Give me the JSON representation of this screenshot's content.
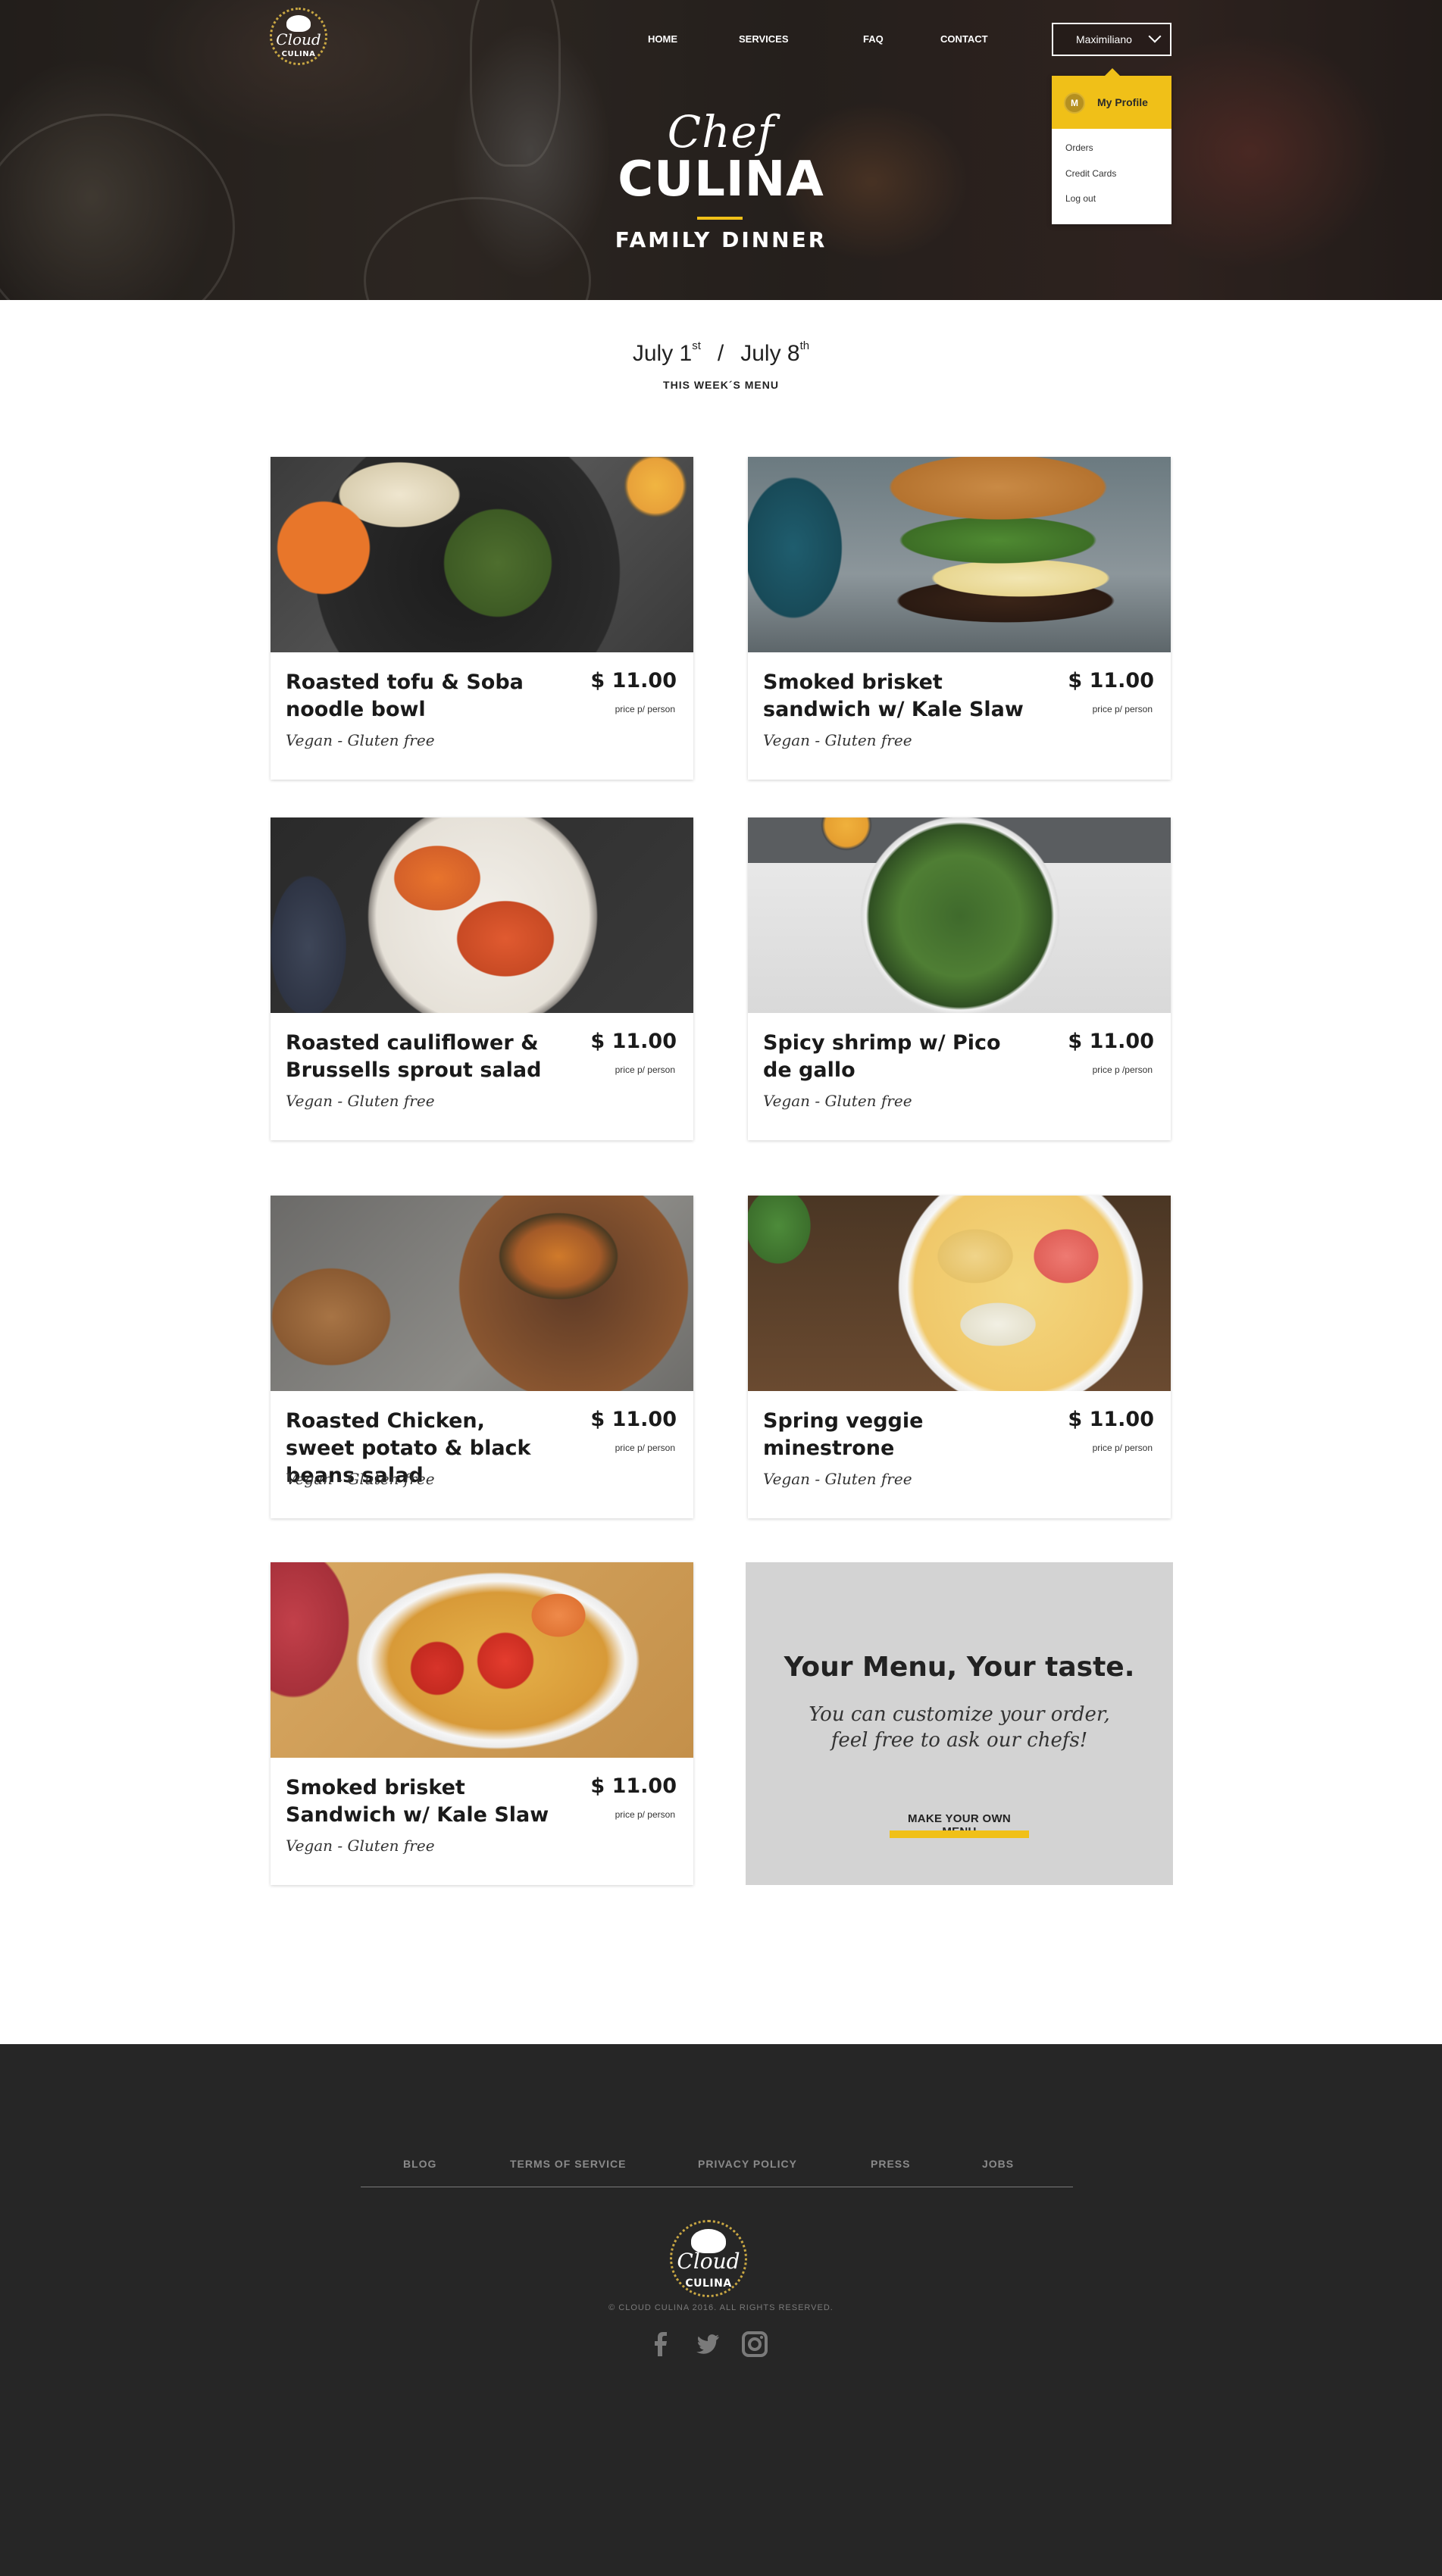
{
  "brand": {
    "logo_script": "Cloud",
    "logo_word": "CULINA"
  },
  "nav": {
    "home": "HOME",
    "services": "SERVICES",
    "faq": "FAQ",
    "contact": "CONTACT"
  },
  "user_menu": {
    "name": "Maximiliano",
    "avatar_letter": "M",
    "profile_label": "My Profile",
    "items": [
      "Orders",
      "Credit Cards",
      "Log out"
    ],
    "accent_color": "#f0c018"
  },
  "hero": {
    "script_title": "Chef",
    "main_title": "CULINA",
    "subtitle": "FAMILY DINNER"
  },
  "week": {
    "start_day": "July 1",
    "start_suffix": "st",
    "separator": "/",
    "end_day": "July 8",
    "end_suffix": "th",
    "label": "THIS WEEK´S MENU"
  },
  "menu": [
    {
      "title": "Roasted tofu & Soba noodle bowl",
      "price": "$ 11.00",
      "unit": "price p/ person",
      "tags": "Vegan - Gluten free"
    },
    {
      "title": "Smoked brisket sandwich w/ Kale Slaw",
      "price": "$ 11.00",
      "unit": "price p/ person",
      "tags": "Vegan - Gluten free"
    },
    {
      "title": "Roasted cauliflower & Brussells sprout salad",
      "price": "$ 11.00",
      "unit": "price p/ person",
      "tags": "Vegan - Gluten free"
    },
    {
      "title": "Spicy shrimp w/ Pico de gallo",
      "price": "$ 11.00",
      "unit": "price p /person",
      "tags": "Vegan - Gluten free"
    },
    {
      "title": "Roasted Chicken, sweet potato & black beans salad",
      "price": "$ 11.00",
      "unit": "price p/ person",
      "tags": "Vegan - Gluten free"
    },
    {
      "title": "Spring veggie minestrone",
      "price": "$ 11.00",
      "unit": "price p/ person",
      "tags": "Vegan - Gluten free"
    },
    {
      "title": "Smoked brisket Sandwich w/ Kale Slaw",
      "price": "$ 11.00",
      "unit": "price p/ person",
      "tags": "Vegan - Gluten free"
    }
  ],
  "promo": {
    "title": "Your Menu, Your taste.",
    "text": "You can customize your order, feel free to ask our chefs!",
    "link": "MAKE YOUR OWN MENU"
  },
  "footer": {
    "links": [
      "BLOG",
      "TERMS OF SERVICE",
      "PRIVACY POLICY",
      "PRESS",
      "JOBS"
    ],
    "copyright": "© CLOUD CULINA 2016. ALL RIGHTS RESERVED.",
    "social_icons": [
      "facebook-icon",
      "twitter-icon",
      "instagram-icon"
    ]
  }
}
